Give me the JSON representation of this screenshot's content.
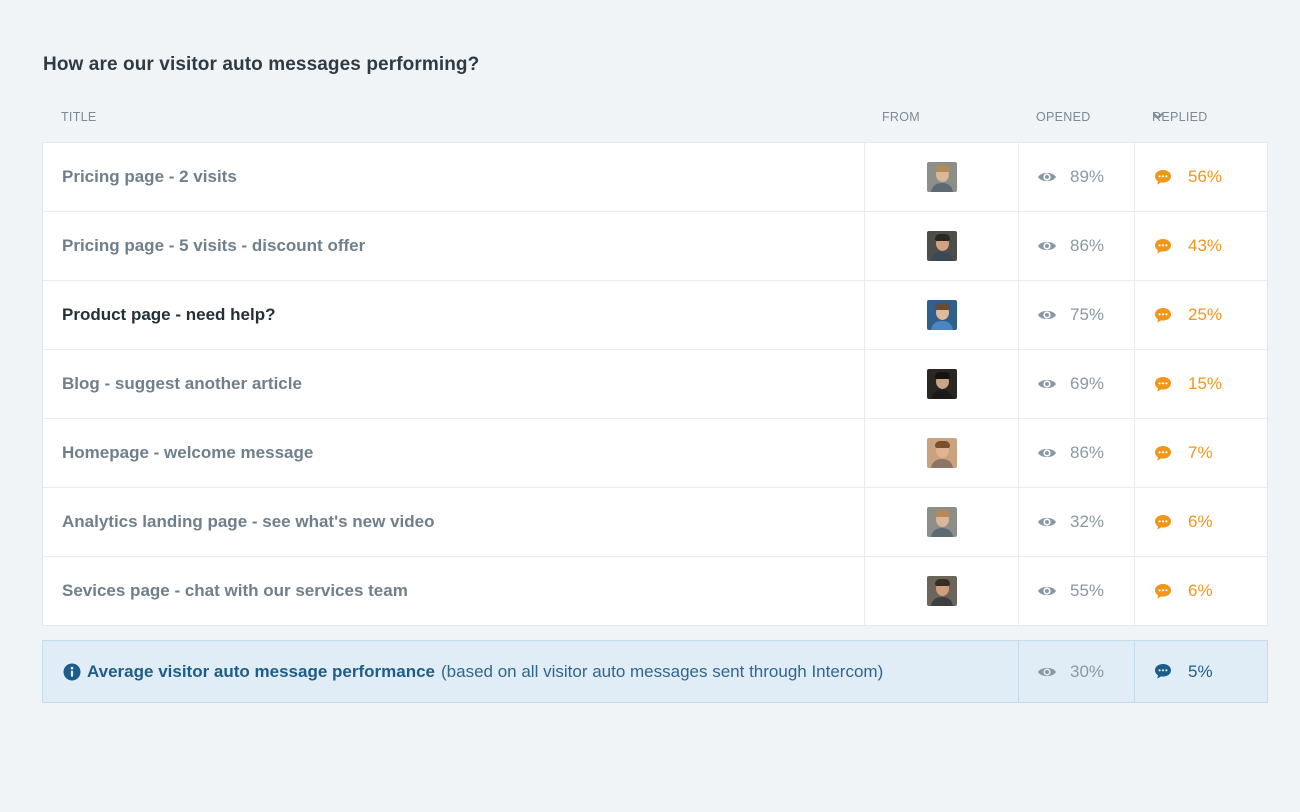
{
  "page_title": "How are our visitor auto messages performing?",
  "columns": {
    "title": "TITLE",
    "from": "FROM",
    "opened": "OPENED",
    "replied": "REPLIED"
  },
  "sort_indicator_icon": "chevron-down-icon",
  "colors": {
    "accent_orange": "#f0961b",
    "summary_blue": "#1d5d8a",
    "summary_bg": "#e1edf6"
  },
  "rows": [
    {
      "title": "Pricing page - 2 visits",
      "opened": "89%",
      "replied": "56%",
      "avatar": {
        "bg": "#8b8f88",
        "skin": "#d9b79b",
        "hair": "#b58a5a",
        "shirt": "#5d6a74"
      }
    },
    {
      "title": "Pricing page - 5 visits - discount offer",
      "opened": "86%",
      "replied": "43%",
      "avatar": {
        "bg": "#4a4f4a",
        "skin": "#d2a283",
        "hair": "#2b2622",
        "shirt": "#3a4954"
      }
    },
    {
      "title": "Product page - need help?",
      "opened": "75%",
      "replied": "25%",
      "avatar": {
        "bg": "#2f5f8a",
        "skin": "#e1b99b",
        "hair": "#6a4b33",
        "shirt": "#4a86c0"
      }
    },
    {
      "title": "Blog - suggest another article",
      "opened": "69%",
      "replied": "15%",
      "avatar": {
        "bg": "#2a2622",
        "skin": "#c8a488",
        "hair": "#15120f",
        "shirt": "#1c1a18"
      }
    },
    {
      "title": "Homepage - welcome message",
      "opened": "86%",
      "replied": "7%",
      "avatar": {
        "bg": "#c9a27f",
        "skin": "#e3b291",
        "hair": "#7a4f2e",
        "shirt": "#8f7563"
      }
    },
    {
      "title": "Analytics landing page - see what's new video",
      "opened": "32%",
      "replied": "6%",
      "avatar": {
        "bg": "#8b8f88",
        "skin": "#d9b79b",
        "hair": "#b58a5a",
        "shirt": "#5d6a74"
      }
    },
    {
      "title": "Sevices page - chat with our services team",
      "opened": "55%",
      "replied": "6%",
      "avatar": {
        "bg": "#6b655c",
        "skin": "#cf9f7d",
        "hair": "#3a2c20",
        "shirt": "#3d3f40"
      }
    }
  ],
  "summary": {
    "bold_label": "Average visitor auto message performance",
    "note": "(based on all visitor auto messages sent through Intercom)",
    "opened": "30%",
    "replied": "5%"
  }
}
